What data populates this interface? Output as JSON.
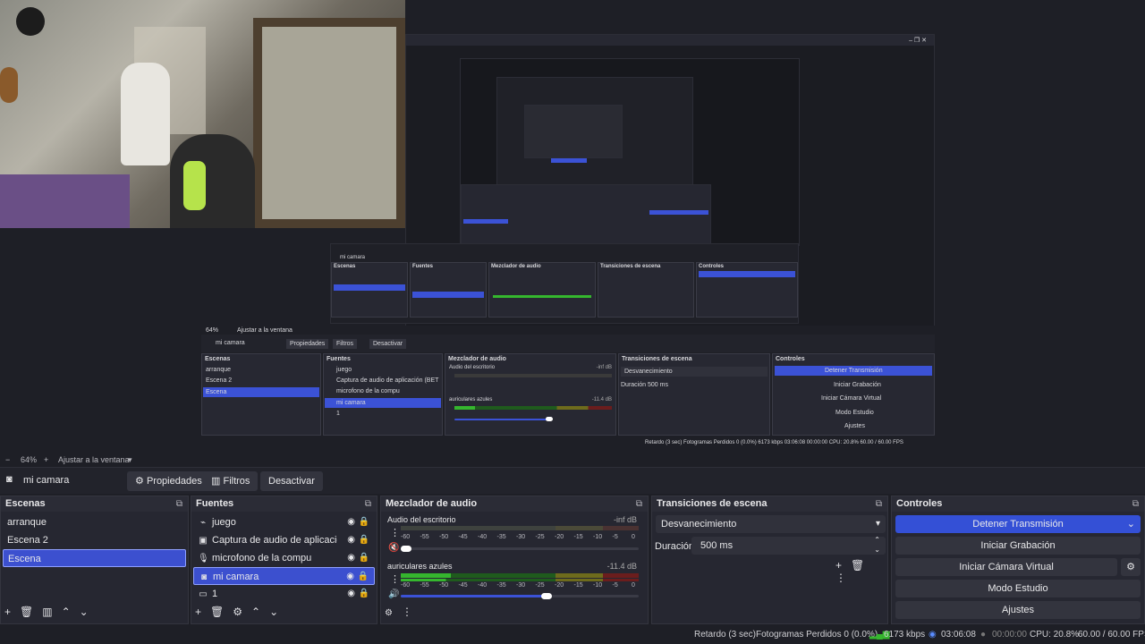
{
  "window_controls": {
    "min": "–",
    "max": "❐",
    "close": "✕"
  },
  "zoom": {
    "minus": "−",
    "level": "64%",
    "plus": "+",
    "fit": "Ajustar a la ventana",
    "dropdown": "▾"
  },
  "source_toolbar": {
    "source_name": "mi camara",
    "properties": "Propiedades",
    "filters": "Filtros",
    "deactivate": "Desactivar"
  },
  "scenes": {
    "title": "Escenas",
    "items": [
      "arranque",
      "Escena 2",
      "Escena"
    ],
    "selected": 2
  },
  "sources": {
    "title": "Fuentes",
    "items": [
      {
        "name": "juego",
        "icon": "gamepad-icon"
      },
      {
        "name": "Captura de audio de aplicación (BET",
        "icon": "app-audio-icon"
      },
      {
        "name": "microfono de la compu",
        "icon": "microphone-icon"
      },
      {
        "name": "mi camara",
        "icon": "camera-icon"
      },
      {
        "name": "1",
        "icon": "display-icon"
      }
    ],
    "selected": 3
  },
  "mixer": {
    "title": "Mezclador de audio",
    "channels": [
      {
        "name": "Audio del escritorio",
        "db": "-inf dB",
        "level": 0.0,
        "volume": 0.02
      },
      {
        "name": "auriculares azules",
        "db": "-11.4 dB",
        "level": 0.21,
        "volume": 0.62
      }
    ],
    "scale": [
      "-60",
      "-55",
      "-50",
      "-45",
      "-40",
      "-35",
      "-30",
      "-25",
      "-20",
      "-15",
      "-10",
      "-5",
      "0"
    ]
  },
  "transitions": {
    "title": "Transiciones de escena",
    "selected": "Desvanecimiento",
    "duration_label": "Duración",
    "duration_value": "500 ms"
  },
  "controls": {
    "title": "Controles",
    "stop_stream": "Detener Transmisión",
    "start_recording": "Iniciar Grabación",
    "virtual_camera": "Iniciar Cámara Virtual",
    "studio_mode": "Modo Estudio",
    "settings": "Ajustes"
  },
  "status": {
    "delay": "Retardo (3 sec)",
    "dropped": "Fotogramas Perdidos 0 (0.0%)",
    "bitrate": "6173 kbps",
    "stream_time": "03:06:08",
    "rec_time": "00:00:00",
    "cpu": "CPU: 20.8%",
    "fps": "60.00 / 60.00 FPS"
  },
  "colors": {
    "accent": "#3b52d6",
    "background": "#1e1f26",
    "panel": "#262731",
    "meter_green": "#35b72e",
    "meter_yellow": "#a8a32a",
    "meter_red": "#b53030"
  },
  "nested_preview": {
    "zoom": "64%",
    "fit": "Ajustar a la ventana",
    "source": "mi camara",
    "properties": "Propiedades",
    "filters": "Filtros",
    "deactivate": "Desactivar",
    "scenes_title": "Escenas",
    "sources_title": "Fuentes",
    "mixer_title": "Mezclador de audio",
    "transitions_title": "Transiciones de escena",
    "controls_title": "Controles",
    "scene_items": [
      "arranque",
      "Escena 2",
      "Escena"
    ],
    "source_items": [
      "juego",
      "Captura de audio de aplicación (BET",
      "microfono de la compu",
      "mi camara",
      "1"
    ],
    "mixer_ch1": "Audio del escritorio",
    "mixer_ch1_db": "-inf dB",
    "mixer_ch2": "auriculares azules",
    "mixer_ch2_db": "-11.4 dB",
    "transition": "Desvanecimiento",
    "duration_label": "Duración",
    "duration": "500 ms",
    "buttons": [
      "Detener Transmisión",
      "Iniciar Grabación",
      "Iniciar Cámara Virtual",
      "Modo Estudio",
      "Ajustes"
    ],
    "status": "Retardo (3 sec)   Fotogramas Perdidos 0 (0.0%)   6173 kbps   03:06:08   00:00:00   CPU: 20.8%   60.00 / 60.00 FPS"
  }
}
